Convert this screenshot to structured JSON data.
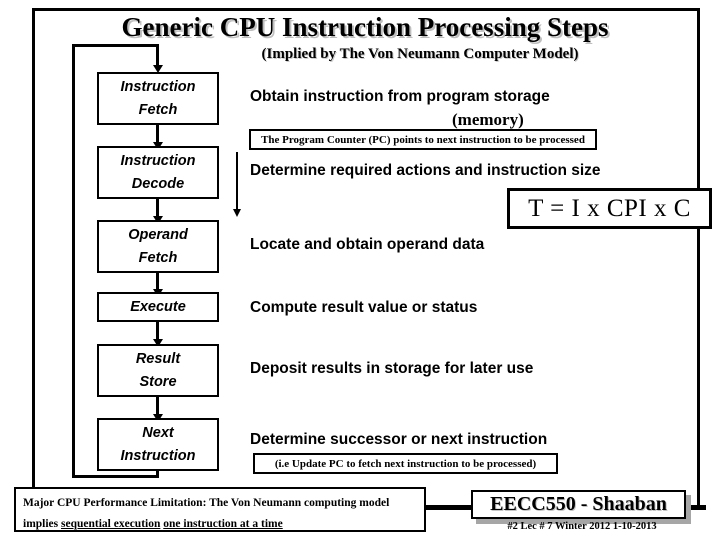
{
  "slide": {
    "title": "Generic CPU Instruction Processing Steps",
    "subtitle": "(Implied by The Von Neumann Computer Model)"
  },
  "steps": [
    {
      "line1": "Instruction",
      "line2": "Fetch"
    },
    {
      "line1": "Instruction",
      "line2": "Decode"
    },
    {
      "line1": "Operand",
      "line2": "Fetch"
    },
    {
      "line1": "Execute",
      "line2": ""
    },
    {
      "line1": "Result",
      "line2": "Store"
    },
    {
      "line1": "Next",
      "line2": "Instruction"
    }
  ],
  "descriptions": {
    "fetch": "Obtain instruction from program storage",
    "fetch_memory": "(memory)",
    "decode": "Determine required actions and instruction size",
    "operand": "Locate and obtain operand data",
    "execute": "Compute result value or status",
    "store": "Deposit results in storage for later use",
    "next": "Determine successor or next instruction"
  },
  "notes": {
    "pc_note": "The Program Counter (PC) points to next instruction to be processed",
    "update_pc_note": "(i.e Update PC to fetch next instruction to be processed)"
  },
  "formula": {
    "text": "T = I x CPI x C"
  },
  "limitation": {
    "line1": "Major CPU Performance Limitation:  The Von Neumann computing model",
    "line2_prefix": "implies ",
    "line2_underlined_a": "sequential execution",
    "line2_gap": " ",
    "line2_underlined_b": "one instruction at a time"
  },
  "footer": {
    "course": "EECC550 - Shaaban",
    "meta": "#2   Lec # 7  Winter 2012  1-10-2013"
  },
  "colors": {
    "ink": "#000000",
    "background": "#ffffff",
    "shadow": "#a6a6a6"
  }
}
